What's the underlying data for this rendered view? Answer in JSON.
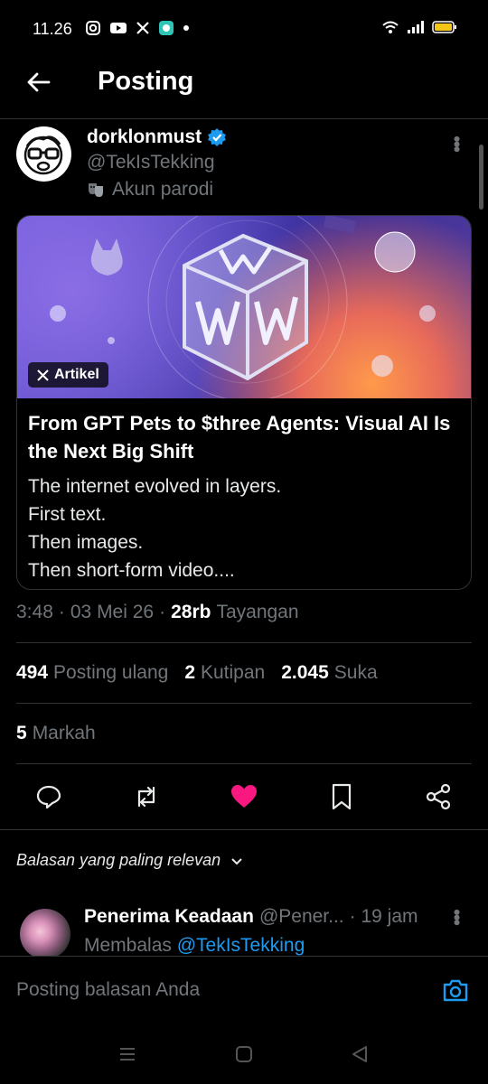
{
  "status": {
    "time": "11.26"
  },
  "header": {
    "title": "Posting"
  },
  "post": {
    "author_name": "dorklonmust",
    "author_handle": "@TekIsTekking",
    "parody_label": "Akun parodi",
    "article": {
      "badge": "Artikel",
      "title": "From GPT Pets to $three Agents: Visual AI Is the Next Big Shift",
      "body_lines": [
        "The internet evolved in layers.",
        "First text.",
        "Then images.",
        "Then short-form video...."
      ]
    },
    "meta": {
      "time": "3:48",
      "dot1": "·",
      "date": "03 Mei 26",
      "dot2": "·",
      "views_count": "28rb",
      "views_label": "Tayangan"
    },
    "stats": {
      "reposts_count": "494",
      "reposts_label": "Posting ulang",
      "quotes_count": "2",
      "quotes_label": "Kutipan",
      "likes_count": "2.045",
      "likes_label": "Suka"
    },
    "bookmarks": {
      "count": "5",
      "label": "Markah"
    }
  },
  "actions": [
    {
      "name": "reply",
      "icon": "reply-icon"
    },
    {
      "name": "repost",
      "icon": "repost-icon"
    },
    {
      "name": "like",
      "icon": "heart-icon",
      "color": "#f91880"
    },
    {
      "name": "bookmark",
      "icon": "bookmark-icon"
    },
    {
      "name": "share",
      "icon": "share-icon"
    }
  ],
  "replies_sort": {
    "label": "Balasan yang paling relevan"
  },
  "reply": {
    "name": "Penerima Keadaan",
    "handle": "@Pener...",
    "time": "· 19 jam",
    "replying_prefix": "Membalas",
    "replying_to": "@TekIsTekking"
  },
  "compose": {
    "placeholder": "Posting balasan Anda"
  },
  "colors": {
    "accent": "#1d9bf0",
    "like": "#f91880",
    "background": "#000000",
    "muted": "#71767b"
  }
}
